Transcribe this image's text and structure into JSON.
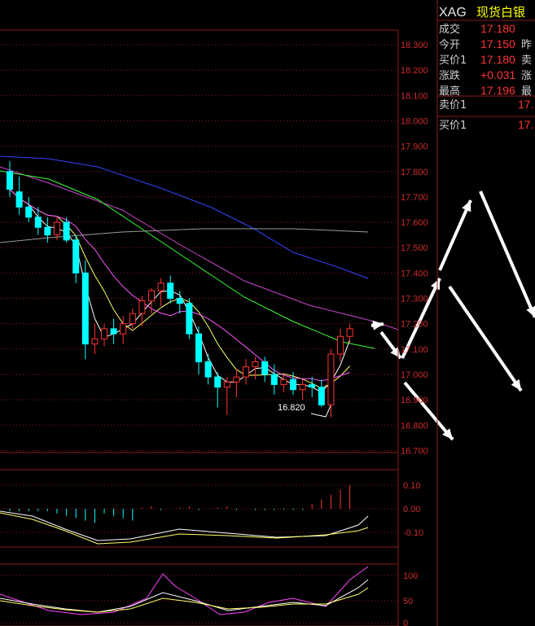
{
  "instrument": {
    "code": "XAG",
    "name": "现货白银"
  },
  "quote_panel": {
    "rows": [
      {
        "label": "成交",
        "value": "17.180",
        "label2": ""
      },
      {
        "label": "今开",
        "value": "17.150",
        "label2": "昨"
      },
      {
        "label": "买价1",
        "value": "17.180",
        "label2": "卖"
      },
      {
        "label": "涨跌",
        "value": "+0.031",
        "label2": "涨"
      },
      {
        "label": "最高",
        "value": "17.196",
        "label2": "最"
      }
    ],
    "book": [
      {
        "label": "卖价1",
        "value": "17."
      },
      {
        "label": "买价1",
        "value": "17."
      }
    ]
  },
  "colors": {
    "up": "#ff3333",
    "down": "#00ffff",
    "frame": "#8b1a1a",
    "axis_text": "#cc2b2b",
    "ma5": "#ffffff",
    "ma10": "#ffff66",
    "ma20": "#ff55ff",
    "ma30": "#33ff33",
    "ma60": "#cc44cc",
    "ma120": "#3344ff",
    "ma250": "#9a9a9a",
    "arrow": "#ffffff"
  },
  "chart_data": [
    {
      "type": "candlestick",
      "yticks": [
        "18.300",
        "18.200",
        "18.100",
        "18.000",
        "17.900",
        "17.800",
        "17.700",
        "17.600",
        "17.500",
        "17.400",
        "17.300",
        "17.200",
        "17.100",
        "17.000",
        "16.900",
        "16.800",
        "16.700"
      ],
      "ylim": [
        16.69,
        18.35
      ],
      "annotation": {
        "text": "16.820",
        "value": 16.82,
        "candle": 26
      },
      "candles": [
        [
          17.8,
          17.84,
          17.7,
          17.73
        ],
        [
          17.72,
          17.78,
          17.63,
          17.66
        ],
        [
          17.66,
          17.7,
          17.6,
          17.62
        ],
        [
          17.62,
          17.66,
          17.55,
          17.58
        ],
        [
          17.58,
          17.62,
          17.52,
          17.55
        ],
        [
          17.55,
          17.62,
          17.53,
          17.6
        ],
        [
          17.6,
          17.62,
          17.52,
          17.53
        ],
        [
          17.53,
          17.55,
          17.36,
          17.4
        ],
        [
          17.4,
          17.45,
          17.06,
          17.12
        ],
        [
          17.12,
          17.2,
          17.08,
          17.14
        ],
        [
          17.14,
          17.2,
          17.11,
          17.18
        ],
        [
          17.18,
          17.22,
          17.12,
          17.16
        ],
        [
          17.16,
          17.23,
          17.12,
          17.2
        ],
        [
          17.2,
          17.26,
          17.18,
          17.24
        ],
        [
          17.24,
          17.31,
          17.19,
          17.29
        ],
        [
          17.29,
          17.34,
          17.24,
          17.33
        ],
        [
          17.33,
          17.38,
          17.27,
          17.36
        ],
        [
          17.36,
          17.39,
          17.28,
          17.3
        ],
        [
          17.3,
          17.33,
          17.24,
          17.28
        ],
        [
          17.28,
          17.3,
          17.14,
          17.16
        ],
        [
          17.16,
          17.19,
          17.0,
          17.05
        ],
        [
          17.05,
          17.08,
          16.96,
          16.99
        ],
        [
          16.99,
          17.01,
          16.87,
          16.95
        ],
        [
          16.95,
          16.99,
          16.84,
          16.97
        ],
        [
          16.97,
          17.02,
          16.91,
          16.99
        ],
        [
          16.99,
          17.06,
          16.96,
          17.03
        ],
        [
          17.03,
          17.07,
          16.98,
          17.05
        ],
        [
          17.05,
          17.07,
          16.97,
          17.0
        ],
        [
          17.0,
          17.04,
          16.92,
          16.96
        ],
        [
          16.96,
          17.0,
          16.93,
          16.98
        ],
        [
          16.98,
          17.01,
          16.92,
          16.94
        ],
        [
          16.94,
          16.98,
          16.9,
          16.96
        ],
        [
          16.96,
          16.99,
          16.91,
          16.95
        ],
        [
          16.95,
          16.98,
          16.87,
          16.88
        ],
        [
          16.88,
          17.1,
          16.83,
          17.08
        ],
        [
          17.08,
          17.18,
          17.05,
          17.15
        ],
        [
          17.15,
          17.2,
          17.12,
          17.18
        ]
      ]
    },
    {
      "type": "bar",
      "name": "MACD",
      "yticks": [
        "0.10",
        "0.00",
        "-0.10"
      ],
      "ylim": [
        -0.15,
        0.15
      ]
    },
    {
      "type": "line",
      "name": "KDJ",
      "yticks": [
        "100",
        "50",
        "0"
      ],
      "ylim": [
        0,
        100
      ]
    }
  ]
}
